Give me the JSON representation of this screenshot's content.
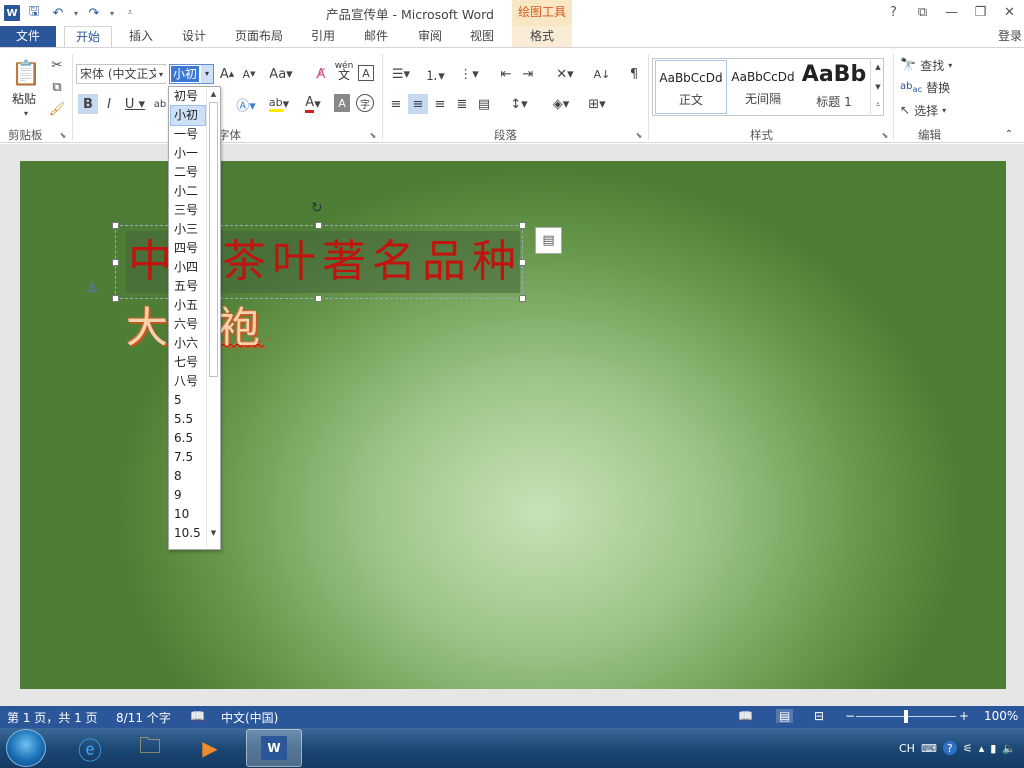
{
  "window": {
    "title": "产品宣传单 - Microsoft Word",
    "contextual_tab_group": "绘图工具",
    "help": "?",
    "controls": [
      "restore-ribbon",
      "minimize",
      "maximize",
      "close"
    ]
  },
  "tabs": [
    "文件",
    "开始",
    "插入",
    "设计",
    "页面布局",
    "引用",
    "邮件",
    "审阅",
    "视图",
    "格式"
  ],
  "login_label": "登录",
  "ribbon": {
    "clipboard": {
      "paste_label": "粘贴",
      "group_label": "剪贴板"
    },
    "font": {
      "font_name": "宋体 (中文正文)",
      "font_size": "小初",
      "group_label": "字体",
      "wen_label": "wén"
    },
    "paragraph": {
      "group_label": "段落"
    },
    "styles": {
      "group_label": "样式",
      "items": [
        {
          "sample": "AaBbCcDd",
          "name": "正文"
        },
        {
          "sample": "AaBbCcDd",
          "name": "无间隔"
        },
        {
          "sample": "AaBb",
          "name": "标题 1"
        }
      ]
    },
    "editing": {
      "find": "查找",
      "replace": "替换",
      "select": "选择",
      "group_label": "编辑"
    }
  },
  "font_size_dropdown": {
    "selected": "小初",
    "options": [
      "初号",
      "小初",
      "一号",
      "小一",
      "二号",
      "小二",
      "三号",
      "小三",
      "四号",
      "小四",
      "五号",
      "小五",
      "六号",
      "小六",
      "七号",
      "八号",
      "5",
      "5.5",
      "6.5",
      "7.5",
      "8",
      "9",
      "10",
      "10.5"
    ]
  },
  "document": {
    "headline_visible": [
      "中",
      "茶叶著名品种"
    ],
    "subline_visible": [
      "大",
      "袍"
    ]
  },
  "status": {
    "page": "第 1 页，共 1 页",
    "words": "8/11 个字",
    "language": "中文(中国)",
    "zoom": "100%",
    "zoom_fraction": 0.5
  },
  "tray": {
    "input": "CH"
  }
}
